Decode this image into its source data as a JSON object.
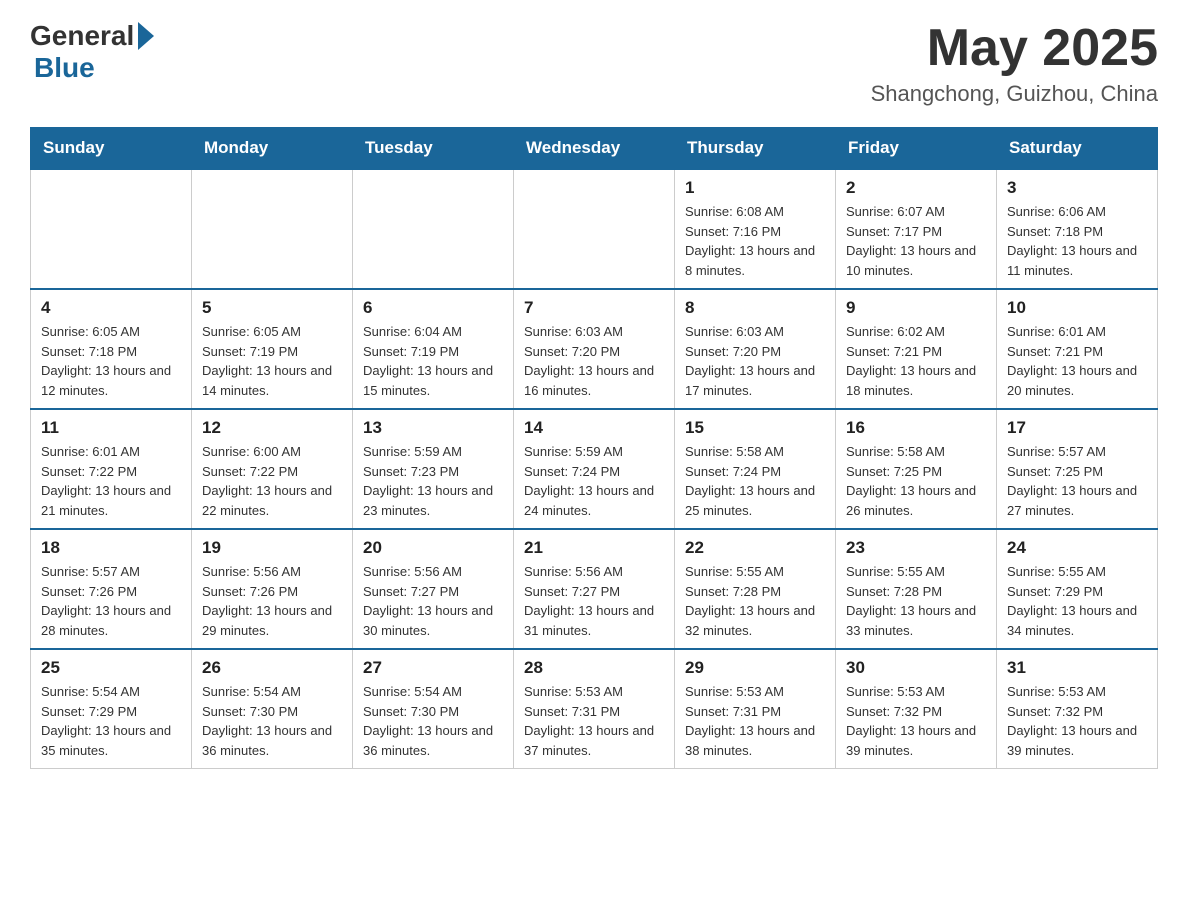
{
  "header": {
    "logo_general": "General",
    "logo_blue": "Blue",
    "month_year": "May 2025",
    "location": "Shangchong, Guizhou, China"
  },
  "weekdays": [
    "Sunday",
    "Monday",
    "Tuesday",
    "Wednesday",
    "Thursday",
    "Friday",
    "Saturday"
  ],
  "weeks": [
    [
      {
        "day": "",
        "info": ""
      },
      {
        "day": "",
        "info": ""
      },
      {
        "day": "",
        "info": ""
      },
      {
        "day": "",
        "info": ""
      },
      {
        "day": "1",
        "info": "Sunrise: 6:08 AM\nSunset: 7:16 PM\nDaylight: 13 hours and 8 minutes."
      },
      {
        "day": "2",
        "info": "Sunrise: 6:07 AM\nSunset: 7:17 PM\nDaylight: 13 hours and 10 minutes."
      },
      {
        "day": "3",
        "info": "Sunrise: 6:06 AM\nSunset: 7:18 PM\nDaylight: 13 hours and 11 minutes."
      }
    ],
    [
      {
        "day": "4",
        "info": "Sunrise: 6:05 AM\nSunset: 7:18 PM\nDaylight: 13 hours and 12 minutes."
      },
      {
        "day": "5",
        "info": "Sunrise: 6:05 AM\nSunset: 7:19 PM\nDaylight: 13 hours and 14 minutes."
      },
      {
        "day": "6",
        "info": "Sunrise: 6:04 AM\nSunset: 7:19 PM\nDaylight: 13 hours and 15 minutes."
      },
      {
        "day": "7",
        "info": "Sunrise: 6:03 AM\nSunset: 7:20 PM\nDaylight: 13 hours and 16 minutes."
      },
      {
        "day": "8",
        "info": "Sunrise: 6:03 AM\nSunset: 7:20 PM\nDaylight: 13 hours and 17 minutes."
      },
      {
        "day": "9",
        "info": "Sunrise: 6:02 AM\nSunset: 7:21 PM\nDaylight: 13 hours and 18 minutes."
      },
      {
        "day": "10",
        "info": "Sunrise: 6:01 AM\nSunset: 7:21 PM\nDaylight: 13 hours and 20 minutes."
      }
    ],
    [
      {
        "day": "11",
        "info": "Sunrise: 6:01 AM\nSunset: 7:22 PM\nDaylight: 13 hours and 21 minutes."
      },
      {
        "day": "12",
        "info": "Sunrise: 6:00 AM\nSunset: 7:22 PM\nDaylight: 13 hours and 22 minutes."
      },
      {
        "day": "13",
        "info": "Sunrise: 5:59 AM\nSunset: 7:23 PM\nDaylight: 13 hours and 23 minutes."
      },
      {
        "day": "14",
        "info": "Sunrise: 5:59 AM\nSunset: 7:24 PM\nDaylight: 13 hours and 24 minutes."
      },
      {
        "day": "15",
        "info": "Sunrise: 5:58 AM\nSunset: 7:24 PM\nDaylight: 13 hours and 25 minutes."
      },
      {
        "day": "16",
        "info": "Sunrise: 5:58 AM\nSunset: 7:25 PM\nDaylight: 13 hours and 26 minutes."
      },
      {
        "day": "17",
        "info": "Sunrise: 5:57 AM\nSunset: 7:25 PM\nDaylight: 13 hours and 27 minutes."
      }
    ],
    [
      {
        "day": "18",
        "info": "Sunrise: 5:57 AM\nSunset: 7:26 PM\nDaylight: 13 hours and 28 minutes."
      },
      {
        "day": "19",
        "info": "Sunrise: 5:56 AM\nSunset: 7:26 PM\nDaylight: 13 hours and 29 minutes."
      },
      {
        "day": "20",
        "info": "Sunrise: 5:56 AM\nSunset: 7:27 PM\nDaylight: 13 hours and 30 minutes."
      },
      {
        "day": "21",
        "info": "Sunrise: 5:56 AM\nSunset: 7:27 PM\nDaylight: 13 hours and 31 minutes."
      },
      {
        "day": "22",
        "info": "Sunrise: 5:55 AM\nSunset: 7:28 PM\nDaylight: 13 hours and 32 minutes."
      },
      {
        "day": "23",
        "info": "Sunrise: 5:55 AM\nSunset: 7:28 PM\nDaylight: 13 hours and 33 minutes."
      },
      {
        "day": "24",
        "info": "Sunrise: 5:55 AM\nSunset: 7:29 PM\nDaylight: 13 hours and 34 minutes."
      }
    ],
    [
      {
        "day": "25",
        "info": "Sunrise: 5:54 AM\nSunset: 7:29 PM\nDaylight: 13 hours and 35 minutes."
      },
      {
        "day": "26",
        "info": "Sunrise: 5:54 AM\nSunset: 7:30 PM\nDaylight: 13 hours and 36 minutes."
      },
      {
        "day": "27",
        "info": "Sunrise: 5:54 AM\nSunset: 7:30 PM\nDaylight: 13 hours and 36 minutes."
      },
      {
        "day": "28",
        "info": "Sunrise: 5:53 AM\nSunset: 7:31 PM\nDaylight: 13 hours and 37 minutes."
      },
      {
        "day": "29",
        "info": "Sunrise: 5:53 AM\nSunset: 7:31 PM\nDaylight: 13 hours and 38 minutes."
      },
      {
        "day": "30",
        "info": "Sunrise: 5:53 AM\nSunset: 7:32 PM\nDaylight: 13 hours and 39 minutes."
      },
      {
        "day": "31",
        "info": "Sunrise: 5:53 AM\nSunset: 7:32 PM\nDaylight: 13 hours and 39 minutes."
      }
    ]
  ]
}
